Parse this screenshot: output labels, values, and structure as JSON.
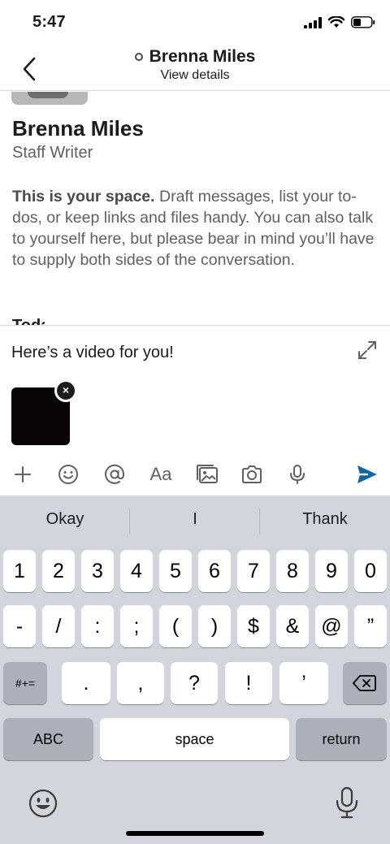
{
  "status_bar": {
    "time": "5:47"
  },
  "header": {
    "title": "Brenna Miles",
    "subtitle": "View details",
    "back_icon": "chevron-left-icon"
  },
  "profile": {
    "name": "Brenna Miles",
    "role": "Staff Writer"
  },
  "intro": {
    "lead": "This is your space.",
    "body": " Draft messages, list your to-dos, or keep links and files handy. You can also talk to yourself here, but please bear in mind you’ll have to supply both sides of the conversation.",
    "cut_off_text": "Today"
  },
  "composer": {
    "text": "Here’s a video for you!",
    "remove_label": "×"
  },
  "toolbar": {
    "format_label": "Aa"
  },
  "keyboard": {
    "suggestions": [
      "Okay",
      "I",
      "Thank"
    ],
    "row1": [
      "1",
      "2",
      "3",
      "4",
      "5",
      "6",
      "7",
      "8",
      "9",
      "0"
    ],
    "row2": [
      "-",
      "/",
      ":",
      ";",
      "(",
      ")",
      "$",
      "&",
      "@",
      "”"
    ],
    "row3_left": "#+=",
    "row3": [
      ".",
      ",",
      "?",
      "!",
      "’"
    ],
    "abc_label": "ABC",
    "space_label": "space",
    "return_label": "return"
  },
  "colors": {
    "send_blue": "#1264a3",
    "keyboard_bg": "#d2d5db",
    "muted_text": "#616061"
  }
}
